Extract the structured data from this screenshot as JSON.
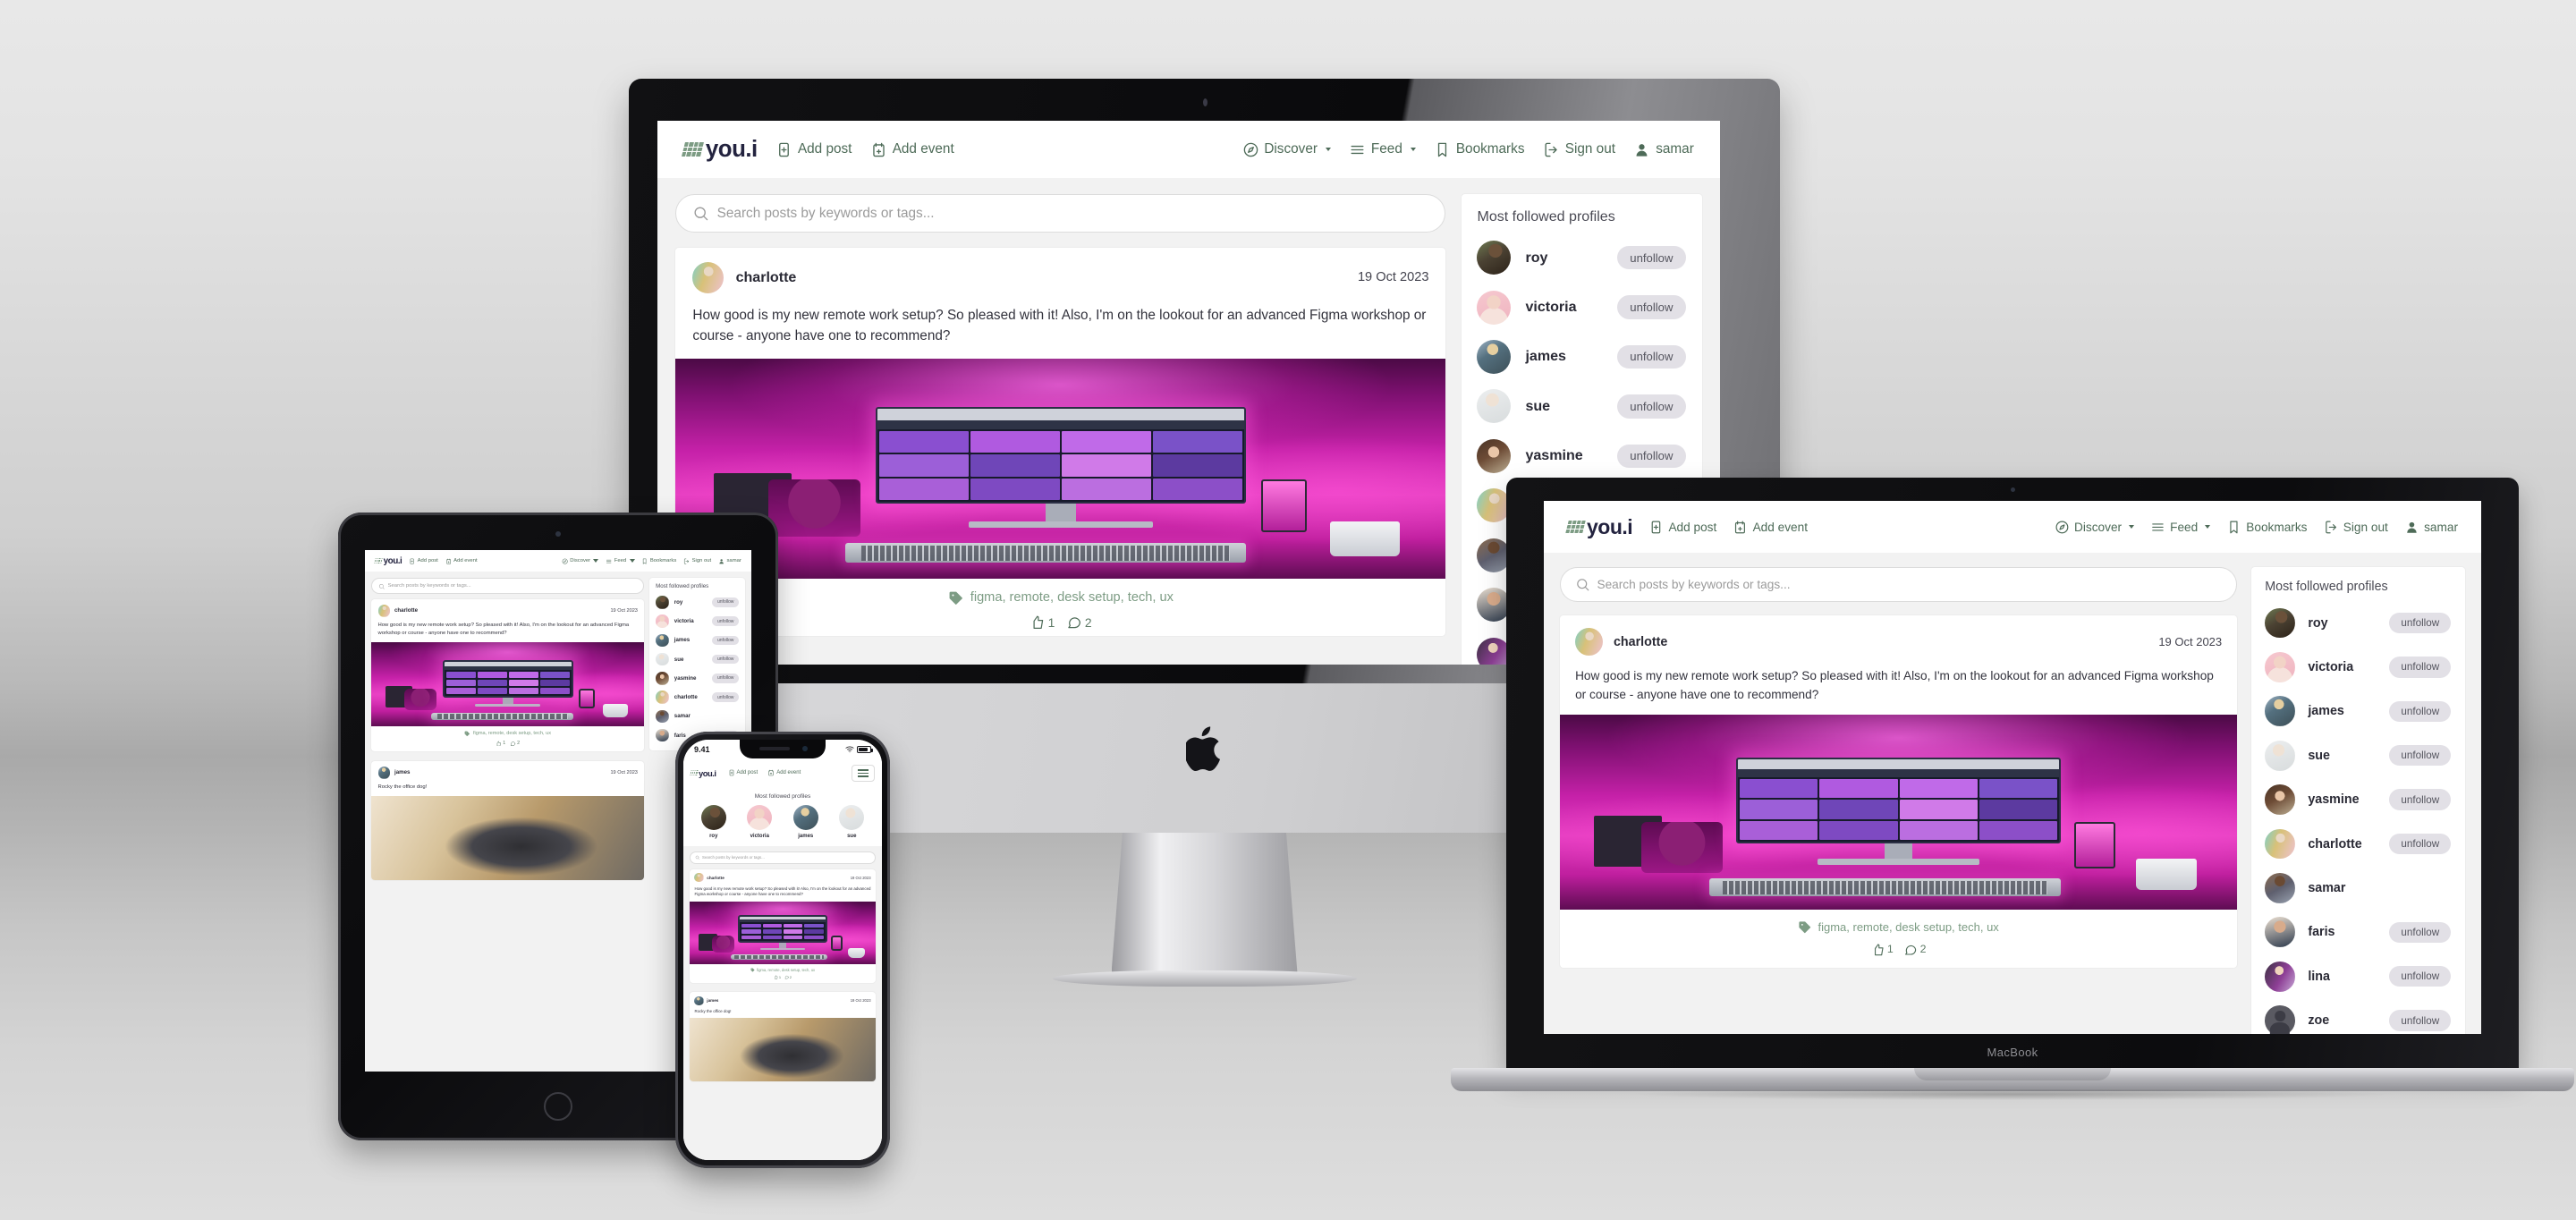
{
  "brand": {
    "name": "you.i"
  },
  "nav": {
    "left": [
      {
        "label": "Add post",
        "icon": "add-post-icon"
      },
      {
        "label": "Add event",
        "icon": "add-event-icon"
      }
    ],
    "right": [
      {
        "label": "Discover",
        "icon": "compass-icon",
        "caret": true
      },
      {
        "label": "Feed",
        "icon": "feed-lines-icon",
        "caret": true
      },
      {
        "label": "Bookmarks",
        "icon": "bookmark-icon",
        "caret": false
      },
      {
        "label": "Sign out",
        "icon": "sign-out-icon",
        "caret": false
      },
      {
        "label": "samar",
        "icon": "user-icon",
        "caret": false
      }
    ]
  },
  "search": {
    "placeholder": "Search posts by keywords or tags..."
  },
  "sidebar": {
    "title": "Most followed profiles",
    "unfollow_label": "unfollow",
    "profiles": [
      {
        "name": "roy",
        "photo": "ph-roy",
        "unfollow": true
      },
      {
        "name": "victoria",
        "photo": "ph-victoria",
        "unfollow": true
      },
      {
        "name": "james",
        "photo": "ph-james",
        "unfollow": true
      },
      {
        "name": "sue",
        "photo": "ph-sue",
        "unfollow": true
      },
      {
        "name": "yasmine",
        "photo": "ph-yasmine",
        "unfollow": true
      },
      {
        "name": "charlotte",
        "photo": "ph-charlotte",
        "unfollow": true
      },
      {
        "name": "samar",
        "photo": "ph-samar",
        "unfollow": false
      },
      {
        "name": "faris",
        "photo": "ph-faris",
        "unfollow": true
      },
      {
        "name": "lina",
        "photo": "ph-lina",
        "unfollow": true
      },
      {
        "name": "zoe",
        "photo": "ph-zoe",
        "unfollow": true
      }
    ],
    "stories": [
      {
        "name": "roy",
        "photo": "ph-roy"
      },
      {
        "name": "victoria",
        "photo": "ph-victoria"
      },
      {
        "name": "james",
        "photo": "ph-james"
      },
      {
        "name": "sue",
        "photo": "ph-sue"
      }
    ]
  },
  "posts": [
    {
      "author": "charlotte",
      "author_photo": "ph-charlotte",
      "date": "19 Oct 2023",
      "text": "How good is my new remote work setup? So pleased with it! Also, I'm on the lookout for an advanced Figma workshop or course - anyone have one to recommend?",
      "image": "deskphoto",
      "tags": "figma, remote, desk setup, tech, ux",
      "likes": "1",
      "comments": "2"
    },
    {
      "author": "james",
      "author_photo": "ph-james",
      "date": "19 Oct 2023",
      "text": "Rocky the office dog!",
      "image": "dogphoto",
      "tags": "",
      "likes": "",
      "comments": ""
    }
  ],
  "phone": {
    "status_time": "9.41",
    "menu_icon": "hamburger-menu-icon"
  },
  "devices": {
    "macbook_label": "MacBook",
    "imac_logo": "apple-logo-icon"
  },
  "colors": {
    "brand_green": "#7d9c84",
    "nav_text": "#4e6b58",
    "brand_navy": "#23233f",
    "chip_bg": "#e2e0e6",
    "page_bg": "#f2f2f2"
  }
}
